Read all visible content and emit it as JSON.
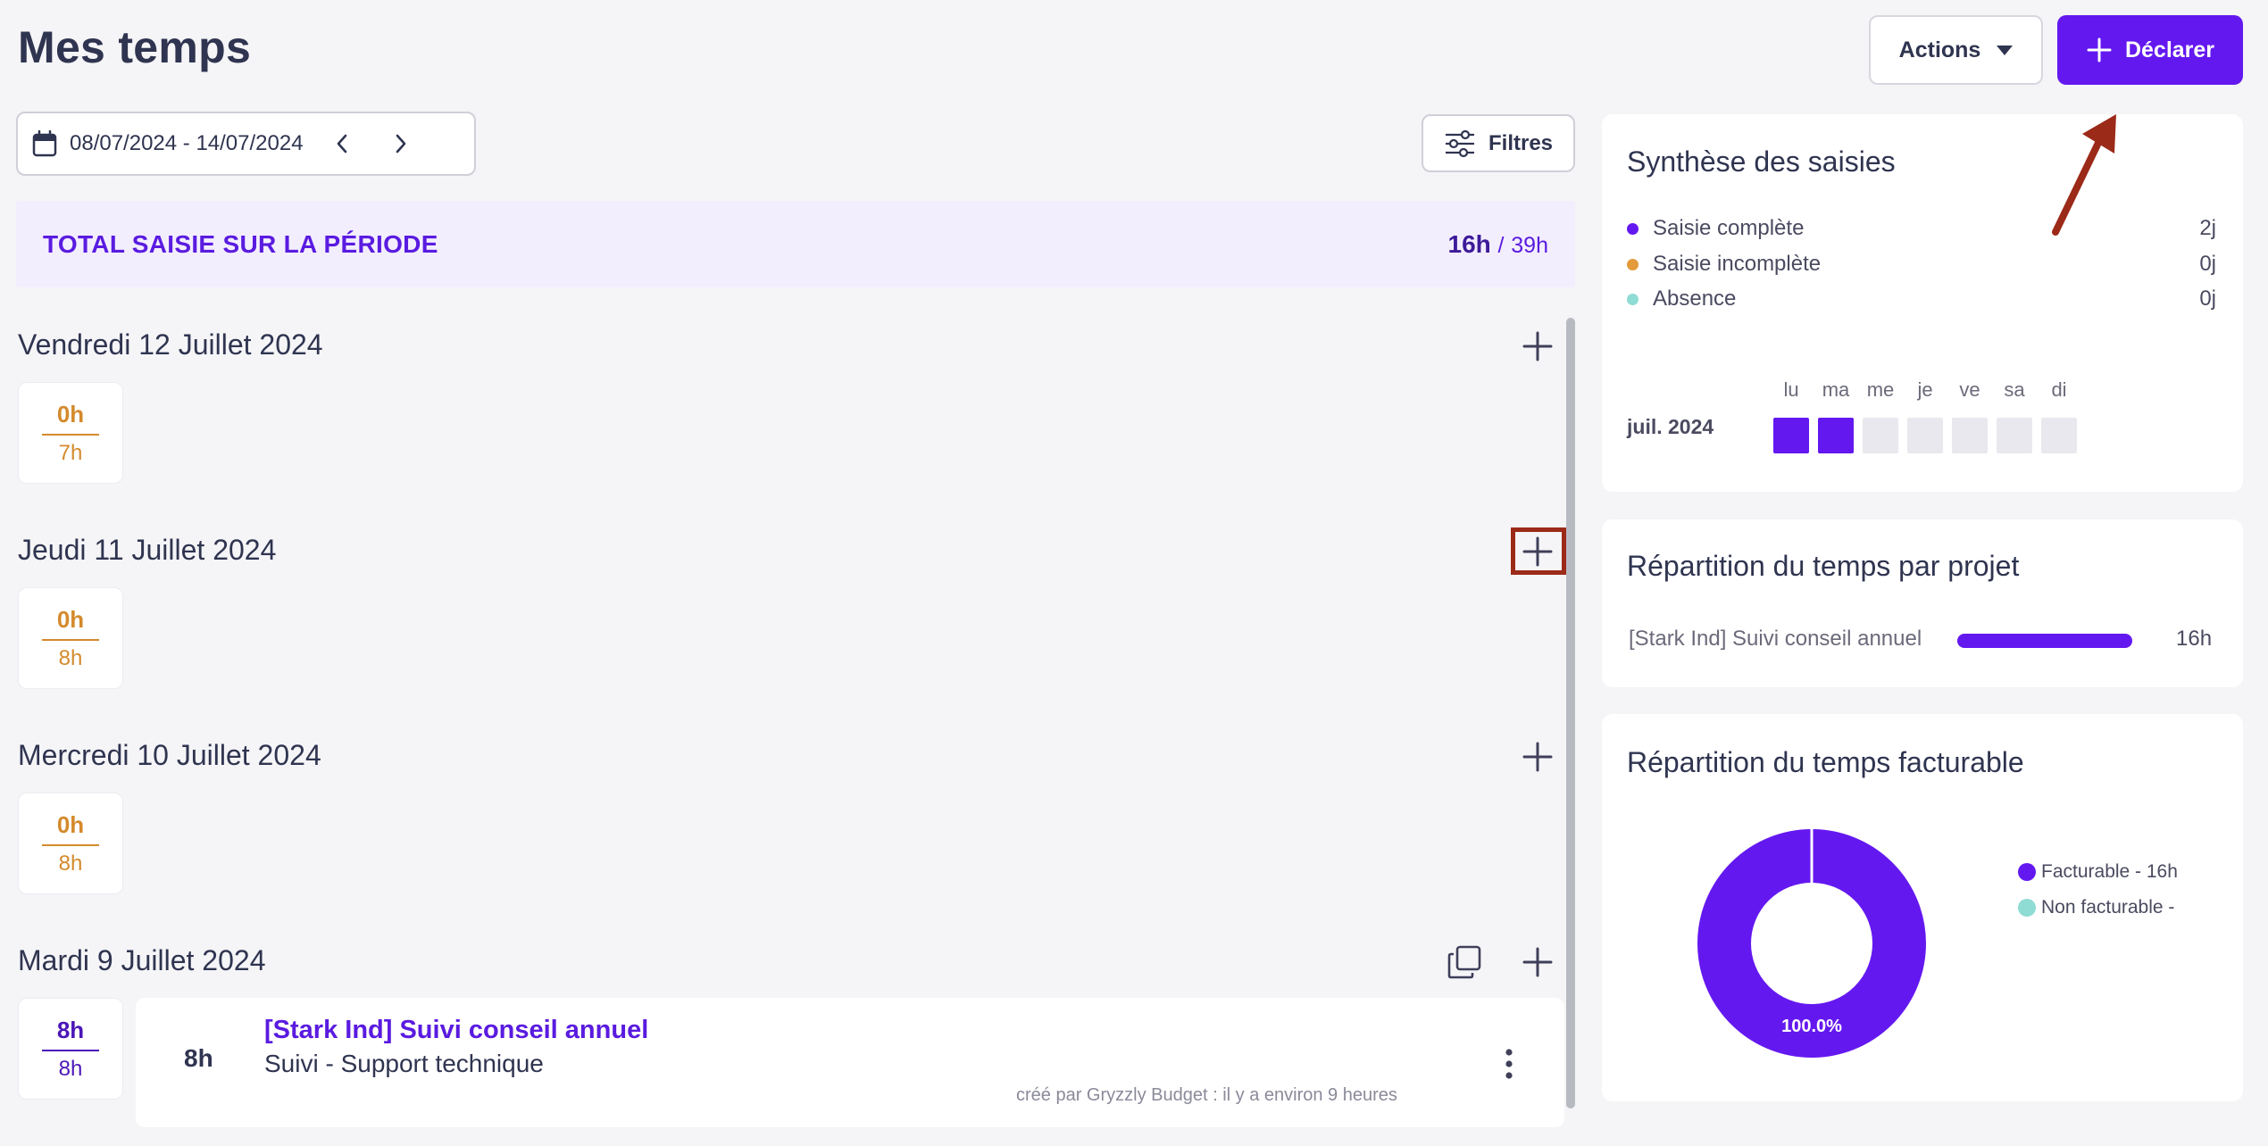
{
  "header": {
    "title": "Mes temps",
    "actions_label": "Actions",
    "declarer_label": "Déclarer"
  },
  "toolbar": {
    "date_range": "08/07/2024 - 14/07/2024",
    "filters_label": "Filtres"
  },
  "total": {
    "label": "TOTAL SAISIE SUR LA PÉRIODE",
    "done": "16h",
    "separator": "/",
    "target": "39h"
  },
  "days": [
    {
      "title": "Vendredi 12 Juillet 2024",
      "done": "0h",
      "target": "7h"
    },
    {
      "title": "Jeudi 11 Juillet 2024",
      "done": "0h",
      "target": "8h"
    },
    {
      "title": "Mercredi 10 Juillet 2024",
      "done": "0h",
      "target": "8h"
    },
    {
      "title": "Mardi 9 Juillet 2024",
      "done": "8h",
      "target": "8h"
    }
  ],
  "entry": {
    "hours": "8h",
    "project": "[Stark Ind] Suivi conseil annuel",
    "task": "Suivi - Support technique",
    "meta": "créé par Gryzzly Budget : il y a environ 9 heures"
  },
  "synthese": {
    "title": "Synthèse des saisies",
    "legend": [
      {
        "label": "Saisie complète",
        "value": "2j",
        "color": "#6418f0"
      },
      {
        "label": "Saisie incomplète",
        "value": "0j",
        "color": "#e39a3b"
      },
      {
        "label": "Absence",
        "value": "0j",
        "color": "#8fdcd4"
      }
    ],
    "month": "juil. 2024",
    "weekdays": [
      "lu",
      "ma",
      "me",
      "je",
      "ve",
      "sa",
      "di"
    ],
    "filled_days": 2
  },
  "projet": {
    "title": "Répartition du temps par projet",
    "rows": [
      {
        "name": "[Stark Ind] Suivi conseil annuel",
        "value": "16h",
        "share": 1.0
      }
    ]
  },
  "facturable": {
    "title": "Répartition du temps facturable",
    "legend": [
      {
        "label": "Facturable - 16h",
        "color": "#6418f0"
      },
      {
        "label": "Non facturable -",
        "color": "#8fdcd4"
      }
    ],
    "percent_label": "100.0%"
  },
  "chart_data": {
    "type": "pie",
    "labels": [
      "Facturable",
      "Non facturable"
    ],
    "values": [
      16,
      0
    ],
    "colors": [
      "#6418f0",
      "#8fdcd4"
    ]
  }
}
